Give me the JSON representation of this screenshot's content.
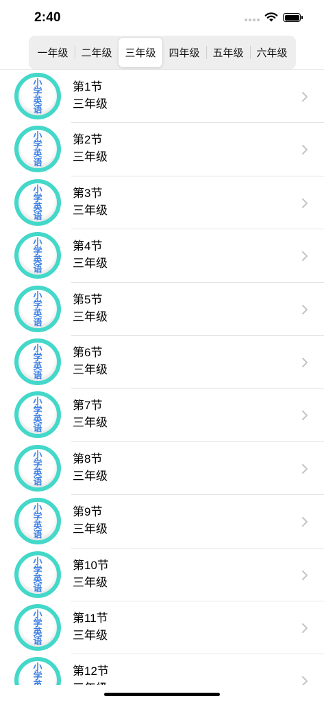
{
  "status_bar": {
    "time": "2:40"
  },
  "tabs": [
    {
      "label": "一年级",
      "selected": false
    },
    {
      "label": "二年级",
      "selected": false
    },
    {
      "label": "三年级",
      "selected": true
    },
    {
      "label": "四年级",
      "selected": false
    },
    {
      "label": "五年级",
      "selected": false
    },
    {
      "label": "六年级",
      "selected": false
    }
  ],
  "lessons": [
    {
      "title": "第1节",
      "subtitle": "三年级"
    },
    {
      "title": "第2节",
      "subtitle": "三年级"
    },
    {
      "title": "第3节",
      "subtitle": "三年级"
    },
    {
      "title": "第4节",
      "subtitle": "三年级"
    },
    {
      "title": "第5节",
      "subtitle": "三年级"
    },
    {
      "title": "第6节",
      "subtitle": "三年级"
    },
    {
      "title": "第7节",
      "subtitle": "三年级"
    },
    {
      "title": "第8节",
      "subtitle": "三年级"
    },
    {
      "title": "第9节",
      "subtitle": "三年级"
    },
    {
      "title": "第10节",
      "subtitle": "三年级"
    },
    {
      "title": "第11节",
      "subtitle": "三年级"
    },
    {
      "title": "第12节",
      "subtitle": "三年级"
    }
  ],
  "logo_text": "小学英语",
  "colors": {
    "logo_ring": "#43d8c9",
    "logo_text": "#3c7fe3",
    "chevron": "#c4c4c7"
  },
  "icons": {
    "chevron": "chevron-right-icon",
    "logo": "primary-english-logo-icon"
  }
}
